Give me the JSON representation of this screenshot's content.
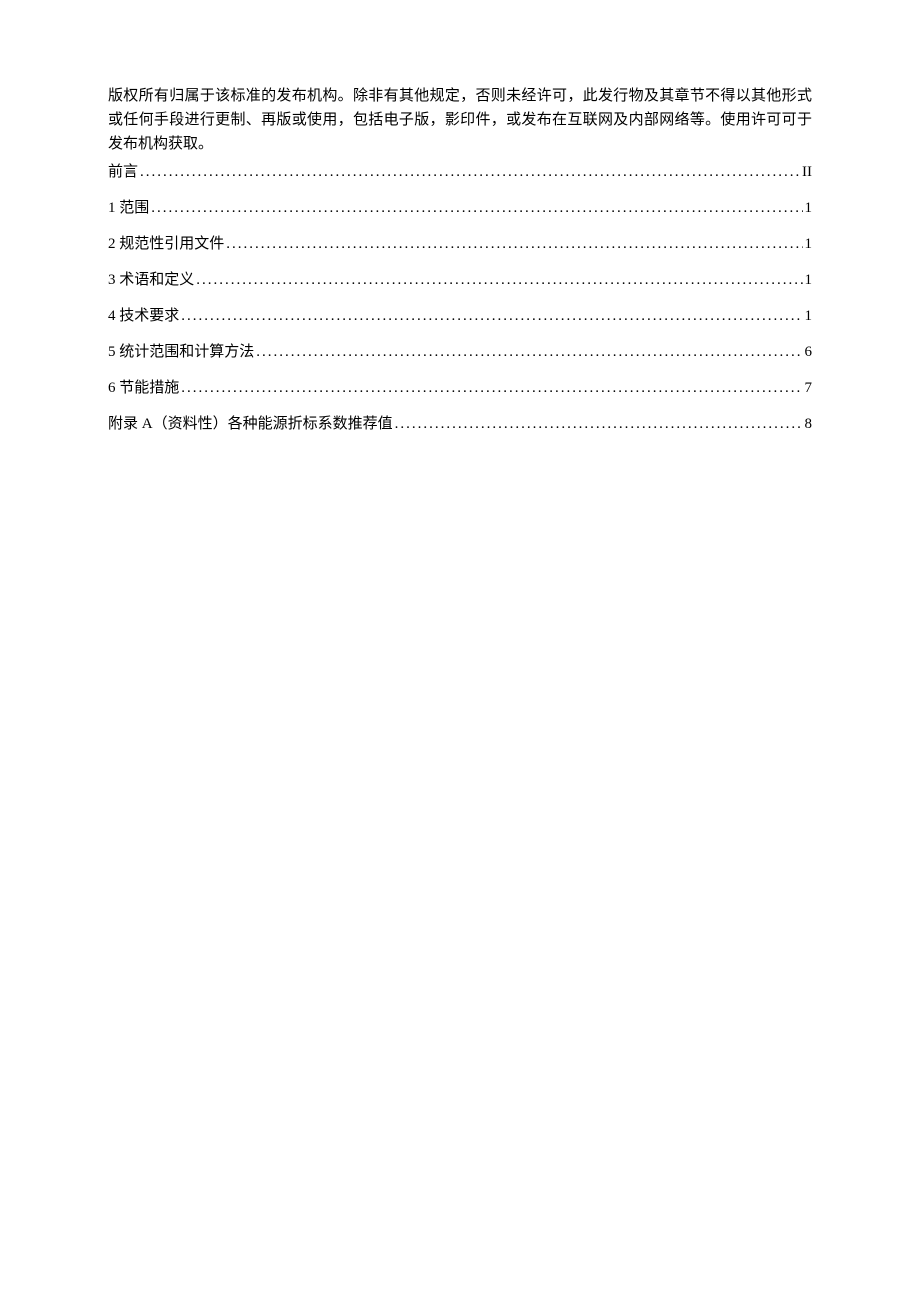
{
  "copyright": "版权所有归属于该标准的发布机构。除非有其他规定，否则未经许可，此发行物及其章节不得以其他形式或任何手段进行更制、再版或使用，包括电子版，影印件，或发布在互联网及内部网络等。使用许可可于发布机构获取。",
  "toc": [
    {
      "label": "前言",
      "page": "II"
    },
    {
      "label": "1 范围",
      "page": "1"
    },
    {
      "label": "2 规范性引用文件",
      "page": "1"
    },
    {
      "label": "3 术语和定义",
      "page": "1"
    },
    {
      "label": "4 技术要求",
      "page": "1"
    },
    {
      "label": "5 统计范围和计算方法",
      "page": "6"
    },
    {
      "label": "6 节能措施",
      "page": "7"
    },
    {
      "label": "附录 A（资料性）各种能源折标系数推荐值",
      "page": "8"
    }
  ]
}
